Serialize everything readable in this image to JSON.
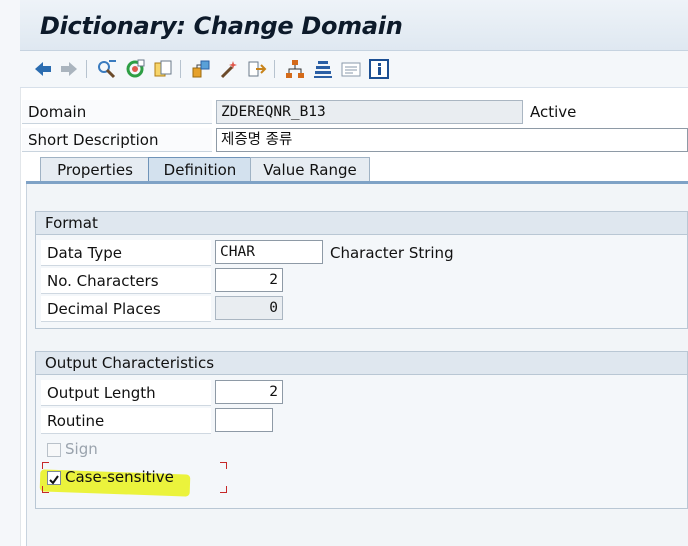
{
  "window": {
    "title": "Dictionary: Change Domain"
  },
  "toolbar": {
    "buttons": [
      {
        "icon": "back-arrow-icon",
        "color": "#2b6cb0"
      },
      {
        "icon": "forward-arrow-icon",
        "color": "#9aa6b2"
      },
      {
        "icon": "display-change-icon",
        "color": "#3a7bbf"
      },
      {
        "icon": "activate-icon",
        "color": "#2e9e44"
      },
      {
        "icon": "copy-object-icon",
        "color": "#d99a1e"
      },
      {
        "icon": "where-used-icon",
        "color": "#c8831a"
      },
      {
        "icon": "check-wand-icon",
        "color": "#c0392b"
      },
      {
        "icon": "object-list-icon",
        "color": "#c8831a"
      },
      {
        "icon": "hierarchy-icon",
        "color": "#d46a1a"
      },
      {
        "icon": "stack-icon",
        "color": "#2b5fa5"
      },
      {
        "icon": "display-list-icon",
        "color": "#8a9aab"
      },
      {
        "icon": "info-icon",
        "color": "#1c4f93"
      }
    ]
  },
  "header": {
    "domain_label": "Domain",
    "domain_value": "ZDEREQNR_B13",
    "status": "Active",
    "short_desc_label": "Short Description",
    "short_desc_value": "제증명 종류"
  },
  "tabs": [
    {
      "label": "Properties",
      "active": false
    },
    {
      "label": "Definition",
      "active": true
    },
    {
      "label": "Value Range",
      "active": false
    }
  ],
  "format": {
    "title": "Format",
    "data_type_label": "Data Type",
    "data_type_value": "CHAR",
    "data_type_desc": "Character String",
    "no_chars_label": "No. Characters",
    "no_chars_value": "2",
    "decimal_label": "Decimal Places",
    "decimal_value": "0"
  },
  "output": {
    "title": "Output Characteristics",
    "output_length_label": "Output Length",
    "output_length_value": "2",
    "routine_label": "Routine",
    "routine_value": "",
    "sign_label": "Sign",
    "sign_checked": false,
    "case_label": "Case-sensitive",
    "case_checked": true
  },
  "colors": {
    "highlight": "#e9f21a",
    "focus_marker": "#c62828",
    "tab_active": "#d3e1ee"
  }
}
